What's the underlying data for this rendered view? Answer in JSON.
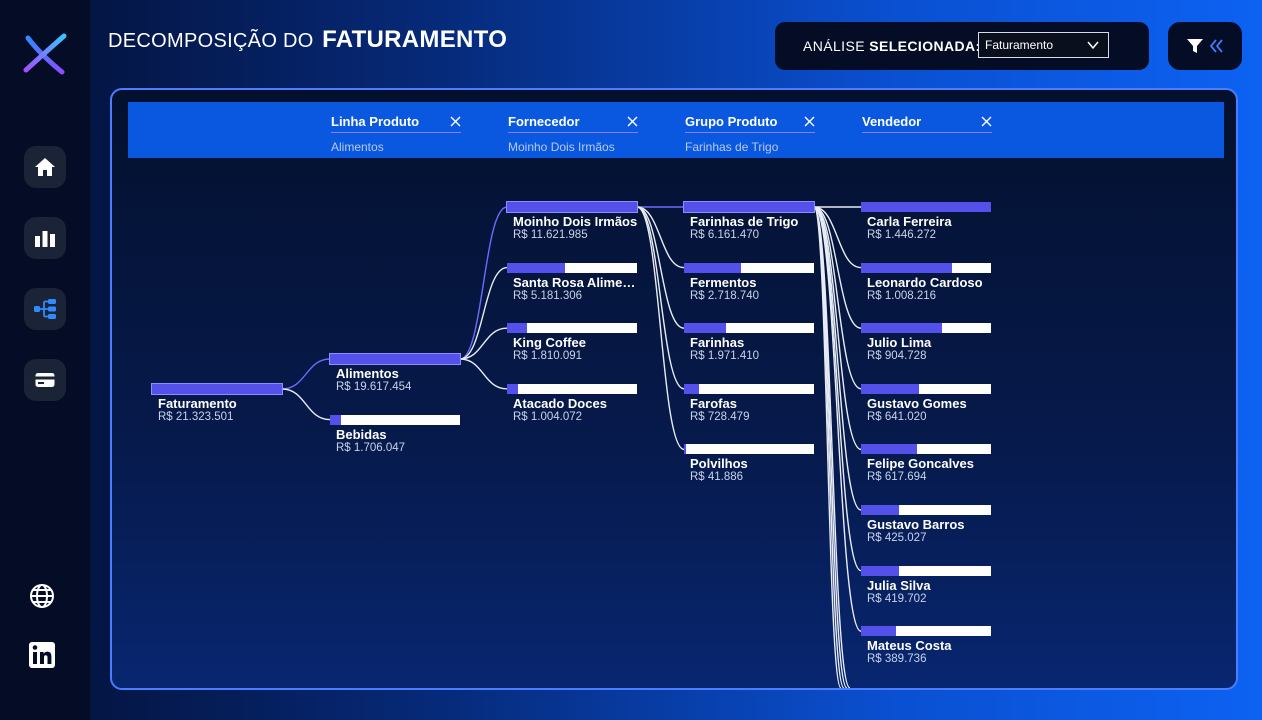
{
  "header": {
    "title_light": "DECOMPOSIÇÃO DO",
    "title_bold": "FATURAMENTO"
  },
  "analysis": {
    "label_light": "ANÁLISE",
    "label_bold": "SELECIONADA:",
    "selected": "Faturamento"
  },
  "sidebar": {
    "items": [
      {
        "name": "home",
        "icon": "home-icon"
      },
      {
        "name": "bar-chart",
        "icon": "bar-chart-icon"
      },
      {
        "name": "decomposition-tree",
        "icon": "tree-icon",
        "active": true
      },
      {
        "name": "card",
        "icon": "credit-card-icon"
      }
    ],
    "social": [
      {
        "name": "globe",
        "icon": "globe-icon"
      },
      {
        "name": "linkedin",
        "icon": "linkedin-icon"
      }
    ]
  },
  "levels": [
    {
      "title": "Linha Produto",
      "selected": "Alimentos"
    },
    {
      "title": "Fornecedor",
      "selected": "Moinho Dois Irmãos"
    },
    {
      "title": "Grupo Produto",
      "selected": "Farinhas de Trigo"
    },
    {
      "title": "Vendedor",
      "selected": ""
    }
  ],
  "tree": {
    "root": {
      "label": "Faturamento",
      "value": "R$ 21.323.501"
    },
    "columns": [
      {
        "nodes": [
          {
            "label": "Alimentos",
            "value": "R$ 19.617.454",
            "fraction": 1.0,
            "selected": true
          },
          {
            "label": "Bebidas",
            "value": "R$ 1.706.047",
            "fraction": 0.087,
            "selected": false
          }
        ]
      },
      {
        "nodes": [
          {
            "label": "Moinho Dois Irmãos",
            "value": "R$ 11.621.985",
            "fraction": 1.0,
            "selected": true
          },
          {
            "label": "Santa Rosa Aliment...",
            "value": "R$ 5.181.306",
            "fraction": 0.446,
            "selected": false
          },
          {
            "label": "King Coffee",
            "value": "R$ 1.810.091",
            "fraction": 0.156,
            "selected": false
          },
          {
            "label": "Atacado Doces",
            "value": "R$ 1.004.072",
            "fraction": 0.086,
            "selected": false
          }
        ]
      },
      {
        "nodes": [
          {
            "label": "Farinhas de Trigo",
            "value": "R$ 6.161.470",
            "fraction": 1.0,
            "selected": true
          },
          {
            "label": "Fermentos",
            "value": "R$ 2.718.740",
            "fraction": 0.441,
            "selected": false
          },
          {
            "label": "Farinhas",
            "value": "R$ 1.971.410",
            "fraction": 0.32,
            "selected": false
          },
          {
            "label": "Farofas",
            "value": "R$ 728.479",
            "fraction": 0.118,
            "selected": false
          },
          {
            "label": "Polvilhos",
            "value": "R$ 41.886",
            "fraction": 0.007,
            "selected": false
          }
        ]
      },
      {
        "nodes": [
          {
            "label": "Carla Ferreira",
            "value": "R$ 1.446.272",
            "fraction": 1.0,
            "selected": false
          },
          {
            "label": "Leonardo Cardoso",
            "value": "R$ 1.008.216",
            "fraction": 0.697,
            "selected": false
          },
          {
            "label": "Julio Lima",
            "value": "R$ 904.728",
            "fraction": 0.626,
            "selected": false
          },
          {
            "label": "Gustavo Gomes",
            "value": "R$ 641.020",
            "fraction": 0.443,
            "selected": false
          },
          {
            "label": "Felipe Goncalves",
            "value": "R$ 617.694",
            "fraction": 0.427,
            "selected": false
          },
          {
            "label": "Gustavo Barros",
            "value": "R$ 425.027",
            "fraction": 0.294,
            "selected": false
          },
          {
            "label": "Julia Silva",
            "value": "R$ 419.702",
            "fraction": 0.29,
            "selected": false
          },
          {
            "label": "Mateus Costa",
            "value": "R$ 389.736",
            "fraction": 0.269,
            "selected": false
          }
        ]
      }
    ]
  },
  "colors": {
    "accent": "#5351ea",
    "bar_bg": "#ffffff",
    "header_bar": "#0a58e0",
    "panel_border": "#4a7dff",
    "sidebar": "#050d26"
  }
}
